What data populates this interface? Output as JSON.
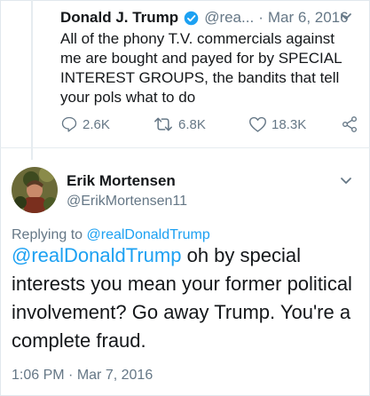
{
  "original_tweet": {
    "name": "Donald J. Trump",
    "handle": "@rea...",
    "separator": "·",
    "date": "Mar 6, 2016",
    "text": "All of the phony T.V. commercials against me are bought and payed for by SPECIAL INTEREST GROUPS, the bandits that tell your pols what to do",
    "replies": "2.6K",
    "retweets": "6.8K",
    "likes": "18.3K"
  },
  "reply_tweet": {
    "name": "Erik Mortensen",
    "handle": "@ErikMortensen11",
    "replying_prefix": "Replying to",
    "replying_to": "@realDonaldTrump",
    "mention": "@realDonaldTrump",
    "text": " oh by special interests you mean your former political involvement?  Go away Trump. You're a complete fraud.",
    "time": "1:06 PM",
    "separator": "·",
    "date": "Mar 7, 2016"
  },
  "colors": {
    "accent": "#1da1f2",
    "muted": "#657786",
    "text": "#14171a",
    "border": "#e6ecf0"
  },
  "icons": [
    "verified-badge-icon",
    "chevron-down-icon",
    "reply-icon",
    "retweet-icon",
    "like-icon",
    "share-icon"
  ]
}
